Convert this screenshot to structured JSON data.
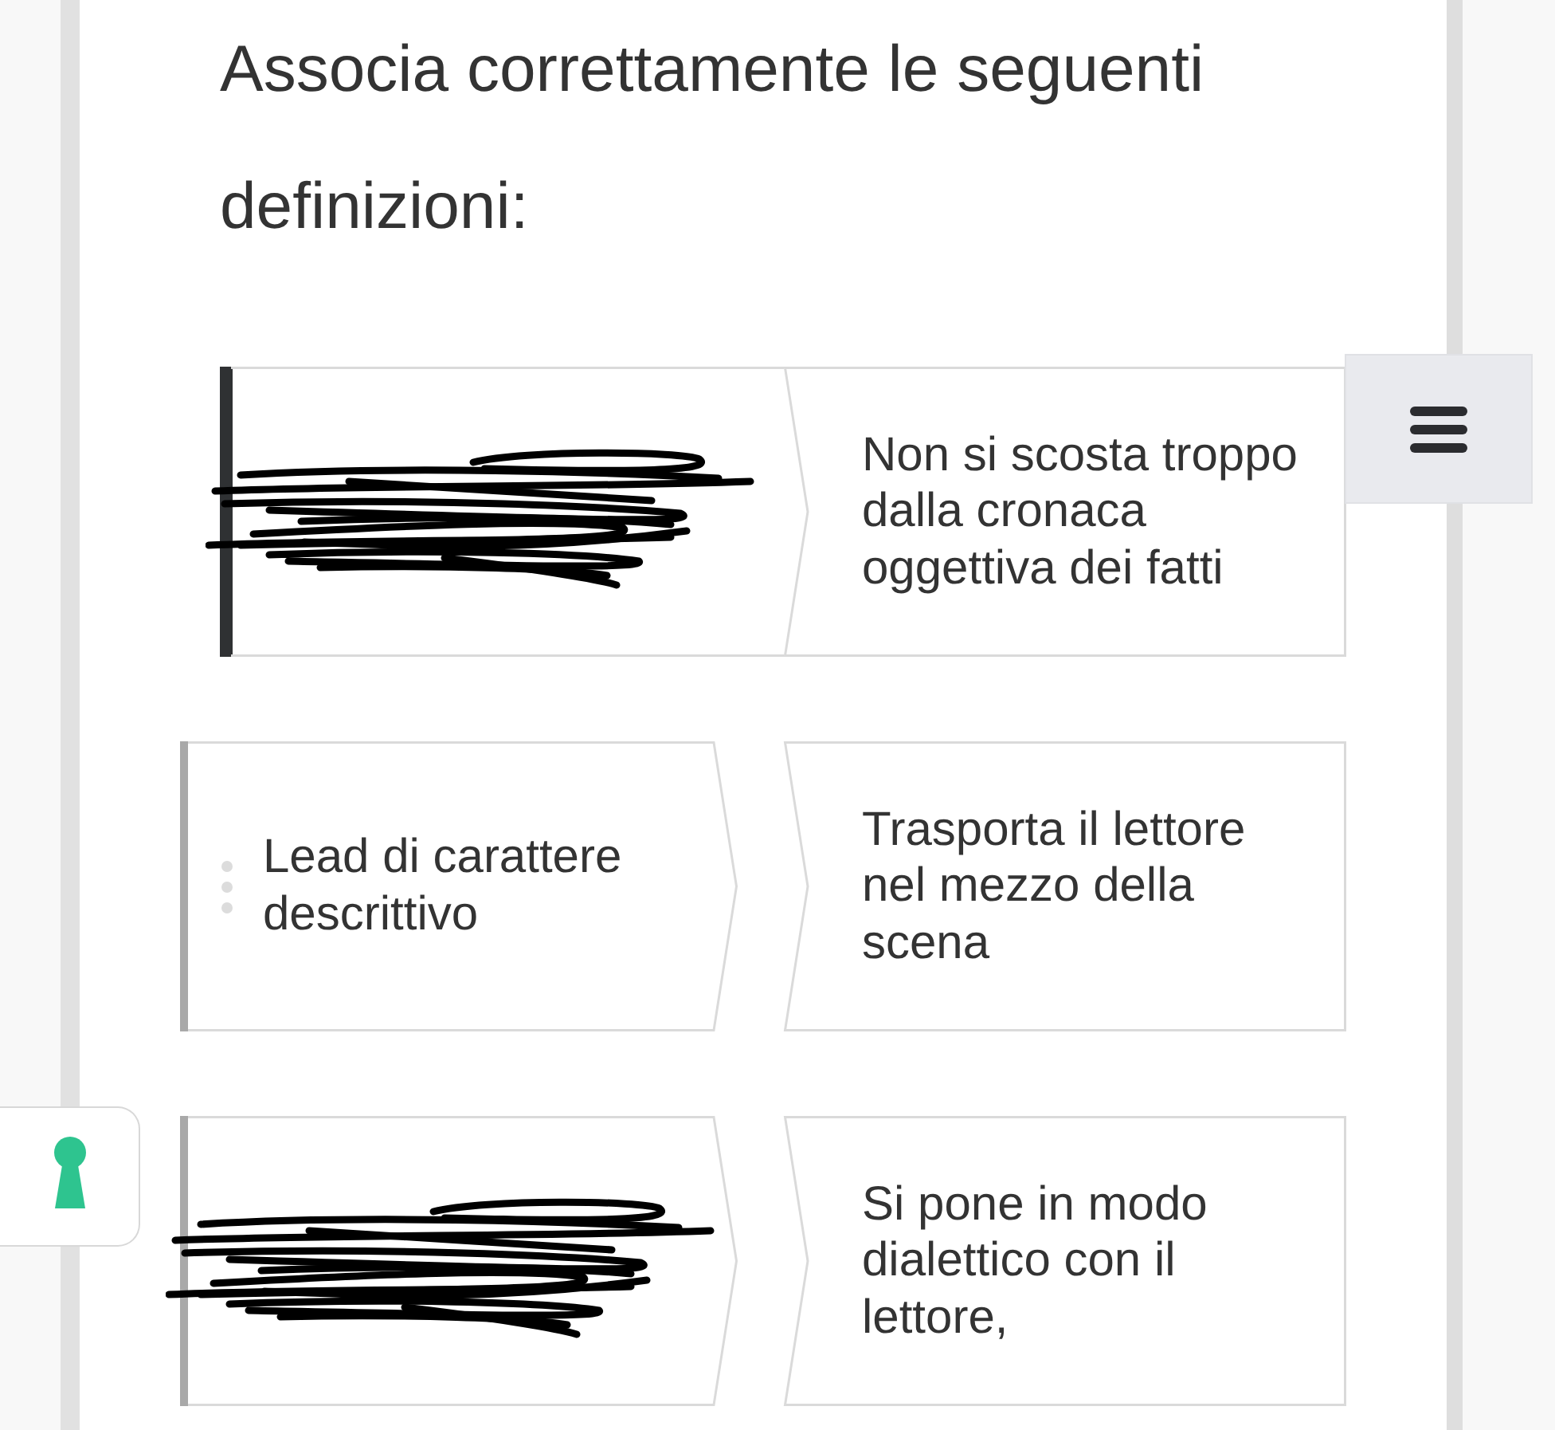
{
  "title": "Associa correttamente le seguenti definizioni:",
  "pairs": [
    {
      "term": {
        "kind": "scribbled",
        "selected": true
      },
      "definition": "Non si scosta troppo dalla cronaca oggettiva dei fatti"
    },
    {
      "term": {
        "kind": "text",
        "label": "Lead di carattere descrittivo",
        "selected": false
      },
      "definition": "Trasporta il lettore nel mezzo della scena"
    },
    {
      "term": {
        "kind": "scribbled",
        "selected": false
      },
      "definition": "Si pone in modo dialettico con il lettore,"
    }
  ]
}
